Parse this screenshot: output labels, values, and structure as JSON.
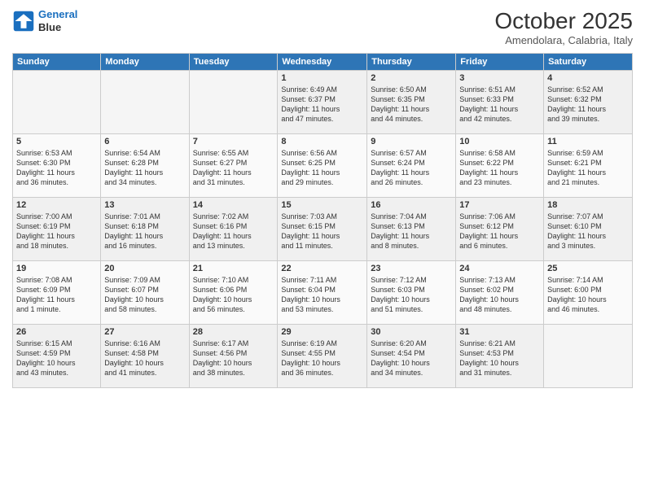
{
  "header": {
    "logo_line1": "General",
    "logo_line2": "Blue",
    "title": "October 2025",
    "subtitle": "Amendolara, Calabria, Italy"
  },
  "weekdays": [
    "Sunday",
    "Monday",
    "Tuesday",
    "Wednesday",
    "Thursday",
    "Friday",
    "Saturday"
  ],
  "weeks": [
    [
      {
        "day": "",
        "info": ""
      },
      {
        "day": "",
        "info": ""
      },
      {
        "day": "",
        "info": ""
      },
      {
        "day": "1",
        "info": "Sunrise: 6:49 AM\nSunset: 6:37 PM\nDaylight: 11 hours\nand 47 minutes."
      },
      {
        "day": "2",
        "info": "Sunrise: 6:50 AM\nSunset: 6:35 PM\nDaylight: 11 hours\nand 44 minutes."
      },
      {
        "day": "3",
        "info": "Sunrise: 6:51 AM\nSunset: 6:33 PM\nDaylight: 11 hours\nand 42 minutes."
      },
      {
        "day": "4",
        "info": "Sunrise: 6:52 AM\nSunset: 6:32 PM\nDaylight: 11 hours\nand 39 minutes."
      }
    ],
    [
      {
        "day": "5",
        "info": "Sunrise: 6:53 AM\nSunset: 6:30 PM\nDaylight: 11 hours\nand 36 minutes."
      },
      {
        "day": "6",
        "info": "Sunrise: 6:54 AM\nSunset: 6:28 PM\nDaylight: 11 hours\nand 34 minutes."
      },
      {
        "day": "7",
        "info": "Sunrise: 6:55 AM\nSunset: 6:27 PM\nDaylight: 11 hours\nand 31 minutes."
      },
      {
        "day": "8",
        "info": "Sunrise: 6:56 AM\nSunset: 6:25 PM\nDaylight: 11 hours\nand 29 minutes."
      },
      {
        "day": "9",
        "info": "Sunrise: 6:57 AM\nSunset: 6:24 PM\nDaylight: 11 hours\nand 26 minutes."
      },
      {
        "day": "10",
        "info": "Sunrise: 6:58 AM\nSunset: 6:22 PM\nDaylight: 11 hours\nand 23 minutes."
      },
      {
        "day": "11",
        "info": "Sunrise: 6:59 AM\nSunset: 6:21 PM\nDaylight: 11 hours\nand 21 minutes."
      }
    ],
    [
      {
        "day": "12",
        "info": "Sunrise: 7:00 AM\nSunset: 6:19 PM\nDaylight: 11 hours\nand 18 minutes."
      },
      {
        "day": "13",
        "info": "Sunrise: 7:01 AM\nSunset: 6:18 PM\nDaylight: 11 hours\nand 16 minutes."
      },
      {
        "day": "14",
        "info": "Sunrise: 7:02 AM\nSunset: 6:16 PM\nDaylight: 11 hours\nand 13 minutes."
      },
      {
        "day": "15",
        "info": "Sunrise: 7:03 AM\nSunset: 6:15 PM\nDaylight: 11 hours\nand 11 minutes."
      },
      {
        "day": "16",
        "info": "Sunrise: 7:04 AM\nSunset: 6:13 PM\nDaylight: 11 hours\nand 8 minutes."
      },
      {
        "day": "17",
        "info": "Sunrise: 7:06 AM\nSunset: 6:12 PM\nDaylight: 11 hours\nand 6 minutes."
      },
      {
        "day": "18",
        "info": "Sunrise: 7:07 AM\nSunset: 6:10 PM\nDaylight: 11 hours\nand 3 minutes."
      }
    ],
    [
      {
        "day": "19",
        "info": "Sunrise: 7:08 AM\nSunset: 6:09 PM\nDaylight: 11 hours\nand 1 minute."
      },
      {
        "day": "20",
        "info": "Sunrise: 7:09 AM\nSunset: 6:07 PM\nDaylight: 10 hours\nand 58 minutes."
      },
      {
        "day": "21",
        "info": "Sunrise: 7:10 AM\nSunset: 6:06 PM\nDaylight: 10 hours\nand 56 minutes."
      },
      {
        "day": "22",
        "info": "Sunrise: 7:11 AM\nSunset: 6:04 PM\nDaylight: 10 hours\nand 53 minutes."
      },
      {
        "day": "23",
        "info": "Sunrise: 7:12 AM\nSunset: 6:03 PM\nDaylight: 10 hours\nand 51 minutes."
      },
      {
        "day": "24",
        "info": "Sunrise: 7:13 AM\nSunset: 6:02 PM\nDaylight: 10 hours\nand 48 minutes."
      },
      {
        "day": "25",
        "info": "Sunrise: 7:14 AM\nSunset: 6:00 PM\nDaylight: 10 hours\nand 46 minutes."
      }
    ],
    [
      {
        "day": "26",
        "info": "Sunrise: 6:15 AM\nSunset: 4:59 PM\nDaylight: 10 hours\nand 43 minutes."
      },
      {
        "day": "27",
        "info": "Sunrise: 6:16 AM\nSunset: 4:58 PM\nDaylight: 10 hours\nand 41 minutes."
      },
      {
        "day": "28",
        "info": "Sunrise: 6:17 AM\nSunset: 4:56 PM\nDaylight: 10 hours\nand 38 minutes."
      },
      {
        "day": "29",
        "info": "Sunrise: 6:19 AM\nSunset: 4:55 PM\nDaylight: 10 hours\nand 36 minutes."
      },
      {
        "day": "30",
        "info": "Sunrise: 6:20 AM\nSunset: 4:54 PM\nDaylight: 10 hours\nand 34 minutes."
      },
      {
        "day": "31",
        "info": "Sunrise: 6:21 AM\nSunset: 4:53 PM\nDaylight: 10 hours\nand 31 minutes."
      },
      {
        "day": "",
        "info": ""
      }
    ]
  ]
}
